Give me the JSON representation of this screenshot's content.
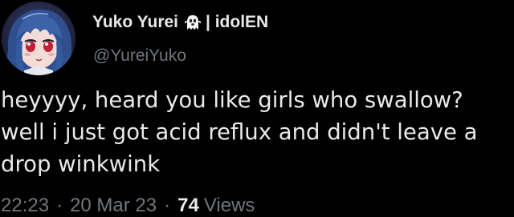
{
  "tweet": {
    "author": {
      "display_name": "Yuko Yurei",
      "badge_icon": "ghost-emoji-icon",
      "name_suffix": "| idolEN",
      "handle": "@YureiYuko",
      "avatar_icon": "anime-girl-avatar"
    },
    "text_lines": [
      "heyyyy, heard you like girls who swallow?",
      "well i just got acid reflux and didn't leave a",
      "drop winkwink"
    ],
    "meta": {
      "time": "22:23",
      "separator": "·",
      "date": "20 Mar 23",
      "views_count": "74",
      "views_label": "Views"
    },
    "colors": {
      "background": "#000000",
      "primary_text": "#e7e9ea",
      "secondary_text": "#71767b"
    }
  }
}
